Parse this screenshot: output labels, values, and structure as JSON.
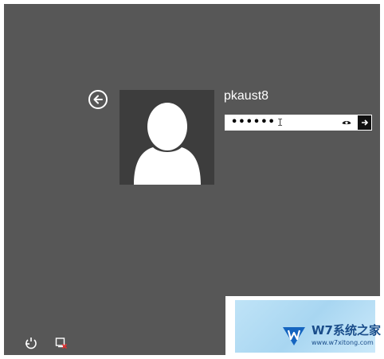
{
  "login": {
    "username": "pkaust8",
    "password_masked": "••••••",
    "caret_glyph": "I"
  },
  "icons": {
    "back": "back-arrow-icon",
    "avatar": "default-user-avatar",
    "reveal": "eye-icon",
    "submit": "right-arrow-icon",
    "ease_of_access": "ease-of-access-icon",
    "power": "power-icon"
  },
  "watermark": {
    "title": "W7系统之家",
    "subtitle": "www.w7xitong.com"
  },
  "colors": {
    "background": "#575757",
    "avatar_bg": "#3d3d3d",
    "watermark_text": "#1a4d8a"
  }
}
